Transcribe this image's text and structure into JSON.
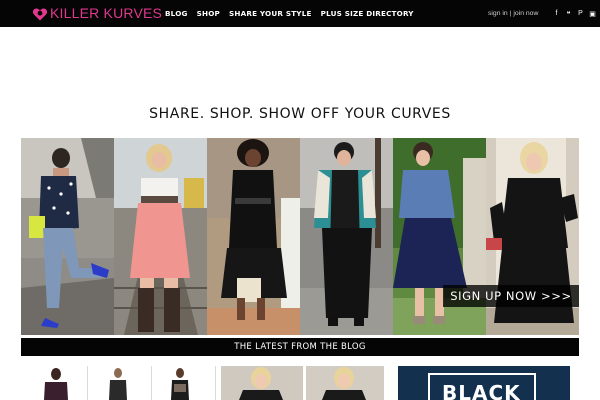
{
  "brand": {
    "name": "KILLER KURVES",
    "accent": "#e0388f"
  },
  "nav": {
    "items": [
      {
        "label": "BLOG"
      },
      {
        "label": "SHOP"
      },
      {
        "label": "SHARE YOUR STYLE"
      },
      {
        "label": "PLUS SIZE DIRECTORY"
      }
    ]
  },
  "auth": {
    "sign_in": "sign in",
    "separator": "|",
    "join": "join now"
  },
  "social": [
    {
      "icon": "facebook-icon",
      "glyph": "f"
    },
    {
      "icon": "twitter-icon",
      "glyph": "❝"
    },
    {
      "icon": "pinterest-icon",
      "glyph": "P"
    },
    {
      "icon": "instagram-icon",
      "glyph": "▣"
    }
  ],
  "hero": {
    "headline": "SHARE. SHOP. SHOW OFF YOUR CURVES",
    "signup_label": "SIGN UP NOW >>>"
  },
  "blog": {
    "title": "THE LATEST FROM THE BLOG"
  },
  "promo": {
    "word": "BLACK"
  }
}
